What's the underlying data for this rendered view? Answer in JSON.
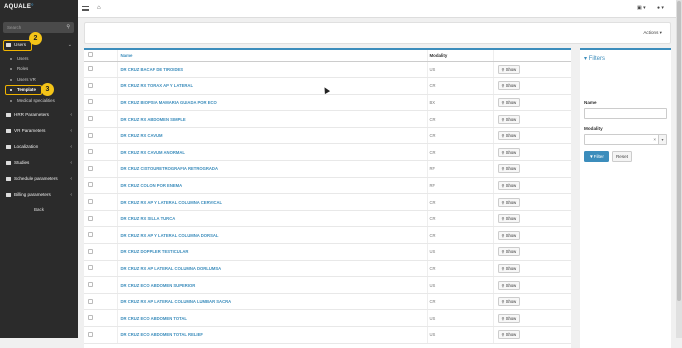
{
  "sidebar": {
    "logo": "AQUALE",
    "search_placeholder": "Search",
    "users_label": "Users",
    "sub_users": [
      "Users",
      "Roles",
      "Users VR",
      "Template",
      "Medical specialities"
    ],
    "menu": [
      "HRR Parameters",
      "VR Parameters",
      "Localization",
      "Studies",
      "Schedule parameters",
      "Billing parameters"
    ],
    "back": "Back",
    "badge_users": "2",
    "badge_template": "3"
  },
  "topbar": {
    "user_icon": "user-icon",
    "dropdown_icon": "grid-icon"
  },
  "actions_label": "Actions ▾",
  "table": {
    "headers": {
      "name": "Name",
      "modality": "Modality"
    },
    "show_label": "Show",
    "rows": [
      {
        "name": "DR CRUZ BACAF DE TIROIDES",
        "modality": "US"
      },
      {
        "name": "DR CRUZ RX TORAX AP Y LATERAL",
        "modality": "CR"
      },
      {
        "name": "DR CRUZ BIOPSIA MAMARIA GUIADA POR ECO",
        "modality": "BX"
      },
      {
        "name": "DR CRUZ RX ABDOMEN SIMPLE",
        "modality": "CR"
      },
      {
        "name": "DR CRUZ RX CAVUM",
        "modality": "CR"
      },
      {
        "name": "DR CRUZ RX CAVUM ANORMAL",
        "modality": "CR"
      },
      {
        "name": "DR CRUZ CISTOURETROGRAFIA RETROGRADA",
        "modality": "RF"
      },
      {
        "name": "DR CRUZ COLON POR ENEMA",
        "modality": "RF"
      },
      {
        "name": "DR CRUZ RX AP Y LATERAL COLUMNA CERVICAL",
        "modality": "CR"
      },
      {
        "name": "DR CRUZ RX SILLA TURCA",
        "modality": "CR"
      },
      {
        "name": "DR CRUZ RX AP Y LATERAL COLUMNA DORSAL",
        "modality": "CR"
      },
      {
        "name": "DR CRUZ DOPPLER TESTICULAR",
        "modality": "US"
      },
      {
        "name": "DR CRUZ RX AP LATERAL COLUMNA DORLUMSA",
        "modality": "CR"
      },
      {
        "name": "DR CRUZ ECO ABDOMEN SUPERIOR",
        "modality": "US"
      },
      {
        "name": "DR CRUZ RX AP LATERAL COLUMNA LUMBAR SACRA",
        "modality": "CR"
      },
      {
        "name": "DR CRUZ ECO ABDOMEN TOTAL",
        "modality": "US"
      },
      {
        "name": "DR CRUZ ECO ABDOMEN TOTAL RELIEF",
        "modality": "US"
      }
    ]
  },
  "filters": {
    "title": "▾ Filters",
    "name_label": "Name",
    "modality_label": "Modality",
    "filter_btn": "Filter",
    "reset_btn": "Reset"
  },
  "colors": {
    "accent": "#3c8dbc",
    "highlight": "#f0b400",
    "sidebar": "#2b2b2b"
  }
}
